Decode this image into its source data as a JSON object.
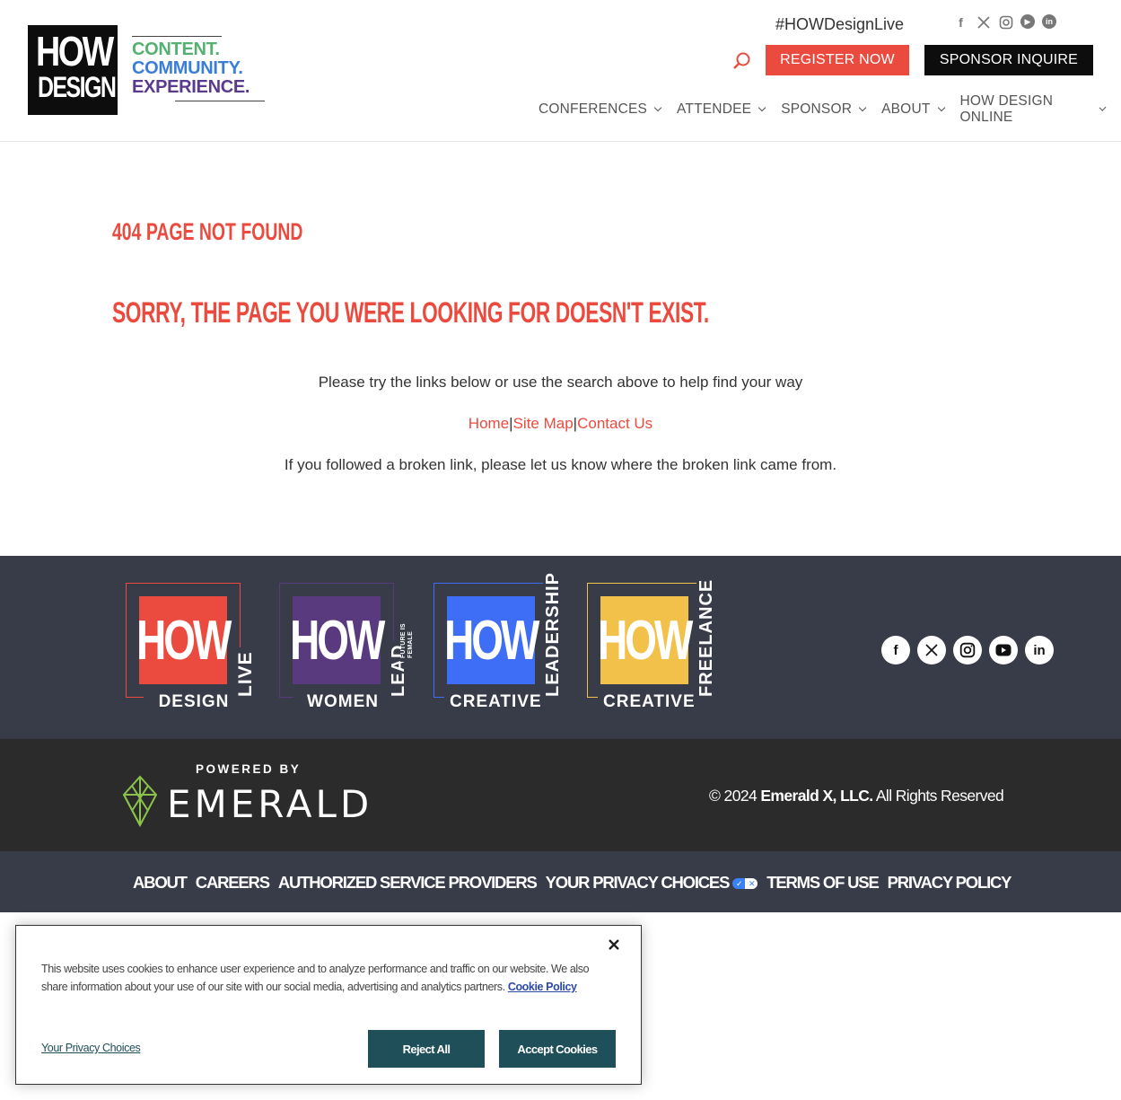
{
  "header": {
    "logo": {
      "line1": "HOW",
      "line2": "DESIGN"
    },
    "tagline": [
      "CONTENT.",
      "COMMUNITY.",
      "EXPERIENCE."
    ],
    "hashtag": "#HOWDesignLive",
    "social_icons": [
      "facebook-icon",
      "x-icon",
      "instagram-icon",
      "youtube-icon",
      "linkedin-icon"
    ],
    "register_label": "REGISTER NOW",
    "sponsor_label": "SPONSOR INQUIRE",
    "nav": [
      "CONFERENCES",
      "ATTENDEE",
      "SPONSOR",
      "ABOUT",
      "HOW DESIGN ONLINE"
    ]
  },
  "main": {
    "heading": "404 PAGE NOT FOUND",
    "subheading": "SORRY, THE PAGE YOU WERE LOOKING FOR DOESN'T EXIST.",
    "try_text": "Please try the links below or use the search above to help find your way",
    "links": [
      "Home",
      "Site Map",
      "Contact Us"
    ],
    "separator": "|",
    "broken_text": "If you followed a broken link, please let us know where the broken link came from."
  },
  "brands": [
    {
      "title": "HOW",
      "bottom": "DESIGN",
      "side": "LIVE",
      "color": "#ea4b3e",
      "frame": "#ea4b3e"
    },
    {
      "title": "HOW",
      "bottom": "WOMEN",
      "side": "LEAD",
      "side_small": "FUTURE IS FEMALE",
      "color": "#5a3a7e",
      "frame": "#5a3a7e"
    },
    {
      "title": "HOW",
      "bottom": "CREATIVE",
      "side": "LEADERSHIP",
      "color": "#3d6ef5",
      "frame": "#3d6ef5"
    },
    {
      "title": "HOW",
      "bottom": "CREATIVE",
      "side": "FREELANCE",
      "color": "#f2c14a",
      "frame": "#f2c14a"
    }
  ],
  "footer_social": [
    "f",
    "𝕏",
    "◎",
    "▶",
    "in"
  ],
  "powered": {
    "label": "POWERED BY",
    "brand": "EMERALD"
  },
  "copyright": {
    "prefix": "© 2024 ",
    "company": "Emerald X, LLC.",
    "suffix": " All Rights Reserved"
  },
  "footer_links": [
    "ABOUT",
    "CAREERS",
    "AUTHORIZED SERVICE PROVIDERS",
    "YOUR PRIVACY CHOICES",
    "TERMS OF USE",
    "PRIVACY POLICY"
  ],
  "cookie": {
    "text": "This website uses cookies to enhance user experience and to analyze performance and traffic on our website. We also share information about your use of our site with our social media, advertising and analytics partners.",
    "policy_link": "Cookie Policy",
    "privacy_choices": "Your Privacy Choices",
    "reject_label": "Reject All",
    "accept_label": "Accept Cookies"
  },
  "colors": {
    "accent": "#ea4b3e",
    "dark_footer": "#383c49",
    "darker_footer": "#2b2b2b",
    "cookie_button": "#1f4f59"
  }
}
